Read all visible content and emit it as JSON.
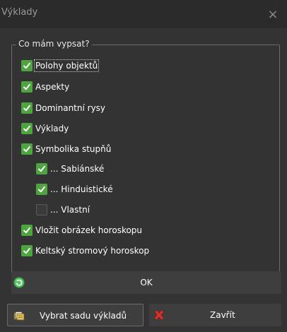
{
  "window": {
    "title": "Výklady",
    "close_glyph": "×"
  },
  "group": {
    "legend": "Co mám vypsat?",
    "items": [
      {
        "label": "Polohy objektů",
        "checked": true
      },
      {
        "label": "Aspekty",
        "checked": true
      },
      {
        "label": "Dominantní rysy",
        "checked": true
      },
      {
        "label": "Výklady",
        "checked": true
      },
      {
        "label": "Symbolika stupňů",
        "checked": true
      },
      {
        "label": "... Sabiánské",
        "checked": true
      },
      {
        "label": "... Hinduistické",
        "checked": true
      },
      {
        "label": "... Vlastní",
        "checked": false
      },
      {
        "label": "Vložit obrázek horoskopu",
        "checked": true
      },
      {
        "label": "Keltský stromový horoskop",
        "checked": true
      }
    ]
  },
  "buttons": {
    "ok_label": "OK",
    "select_set_label": "Vybrat sadu výkladů",
    "close_label": "Zavřít"
  },
  "colors": {
    "check_green": "#4ea43f",
    "close_red": "#e0302a",
    "ok_icon_green": "#3bb14a"
  }
}
